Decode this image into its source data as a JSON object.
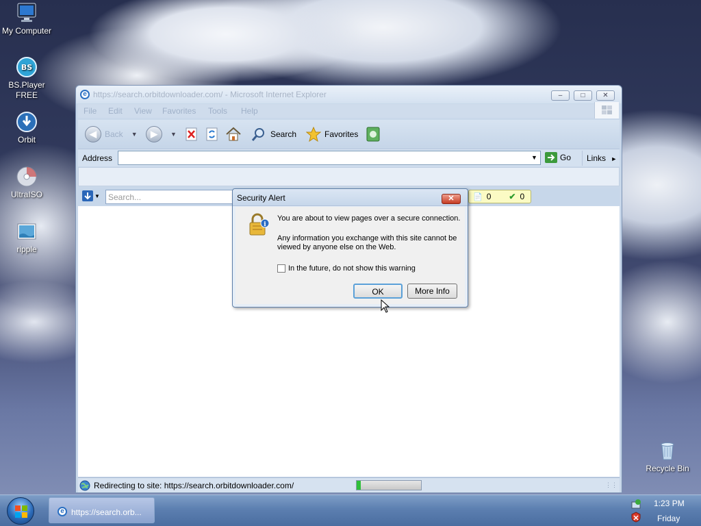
{
  "desktop": {
    "icons": [
      {
        "label": "My Computer",
        "icon": "computer-icon"
      },
      {
        "label": "BS.Player FREE",
        "icon": "bsplayer-icon"
      },
      {
        "label": "Orbit",
        "icon": "orbit-icon"
      },
      {
        "label": "UltraISO",
        "icon": "ultraiso-icon"
      },
      {
        "label": "ripple",
        "icon": "image-file-icon"
      },
      {
        "label": "Recycle Bin",
        "icon": "recycle-bin-icon"
      }
    ]
  },
  "browser": {
    "title": "https://search.orbitdownloader.com/ - Microsoft Internet Explorer",
    "menu": [
      "File",
      "Edit",
      "View",
      "Favorites",
      "Tools",
      "Help"
    ],
    "toolbar": {
      "back": "Back",
      "search": "Search",
      "favorites": "Favorites"
    },
    "address": {
      "label": "Address",
      "value": "",
      "go": "Go",
      "links": "Links"
    },
    "orbit": {
      "search_placeholder": "Search...",
      "count1": "0",
      "count2": "0"
    },
    "status": {
      "text": "Redirecting to site: https://search.orbitdownloader.com/",
      "progress": 0.02
    }
  },
  "dialog": {
    "title": "Security Alert",
    "message": "You are about to view pages over a secure connection.",
    "detail": "Any information you exchange with this site cannot be viewed by anyone else on the Web.",
    "checkbox_label": "In the future, do not show this warning",
    "checkbox_checked": false,
    "ok": "OK",
    "more_info": "More Info"
  },
  "taskbar": {
    "task_label": "https://search.orb...",
    "time": "1:23 PM",
    "day": "Friday"
  }
}
